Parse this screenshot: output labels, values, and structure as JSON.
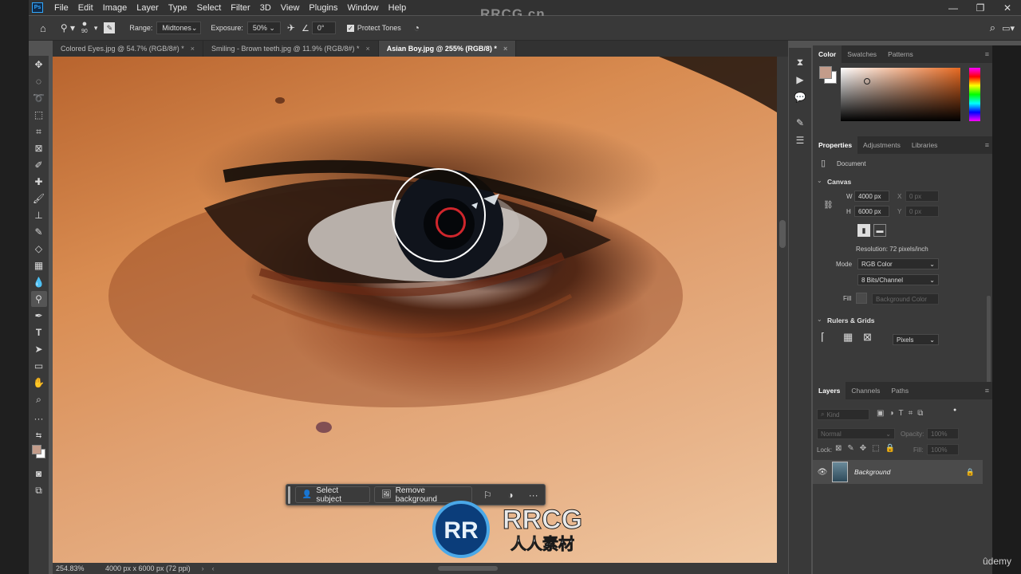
{
  "watermark_top": "RRCG.cn",
  "menu": [
    "File",
    "Edit",
    "Image",
    "Layer",
    "Type",
    "Select",
    "Filter",
    "3D",
    "View",
    "Plugins",
    "Window",
    "Help"
  ],
  "window_controls": [
    "—",
    "❐",
    "✕"
  ],
  "options": {
    "brush_size": "90",
    "range_label": "Range:",
    "range_value": "Midtones",
    "exposure_label": "Exposure:",
    "exposure_value": "50%",
    "angle_value": "0°",
    "protect_tones": "Protect Tones"
  },
  "tabs": [
    {
      "label": "Colored Eyes.jpg @ 54.7% (RGB/8#) *",
      "active": false
    },
    {
      "label": "Smiling - Brown teeth.jpg @ 11.9% (RGB/8#) *",
      "active": false
    },
    {
      "label": "Asian Boy.jpg @ 255% (RGB/8) *",
      "active": true
    }
  ],
  "tab_close": "×",
  "status": {
    "zoom": "254.83%",
    "doc_info": "4000 px x 6000 px (72 ppi)"
  },
  "context_bar": {
    "select_subject": "Select subject",
    "remove_background": "Remove background"
  },
  "logo": {
    "brand": "RRCG",
    "subtitle": "人人素材",
    "initials": "RR"
  },
  "color_panel": {
    "tabs": [
      "Color",
      "Swatches",
      "Patterns"
    ],
    "foreground": "#c39c8a",
    "background": "#ffffff",
    "picker_hue": "#e86a22"
  },
  "properties_panel": {
    "tabs": [
      "Properties",
      "Adjustments",
      "Libraries"
    ],
    "document_label": "Document",
    "canvas_label": "Canvas",
    "w_label": "W",
    "w_value": "4000 px",
    "h_label": "H",
    "h_value": "6000 px",
    "x_label": "X",
    "x_value": "0 px",
    "y_label": "Y",
    "y_value": "0 px",
    "resolution": "Resolution: 72 pixels/inch",
    "mode_label": "Mode",
    "mode_value": "RGB Color",
    "bits_value": "8 Bits/Channel",
    "fill_label": "Fill",
    "fill_value": "Background Color",
    "rulers_label": "Rulers & Grids",
    "units_value": "Pixels"
  },
  "layers_panel": {
    "tabs": [
      "Layers",
      "Channels",
      "Paths"
    ],
    "kind_placeholder": "Kind",
    "blend_mode": "Normal",
    "opacity_label": "Opacity:",
    "opacity_value": "100%",
    "lock_label": "Lock:",
    "fill_label": "Fill:",
    "fill_value": "100%",
    "layer_name": "Background"
  },
  "udemy": "ûdemy"
}
